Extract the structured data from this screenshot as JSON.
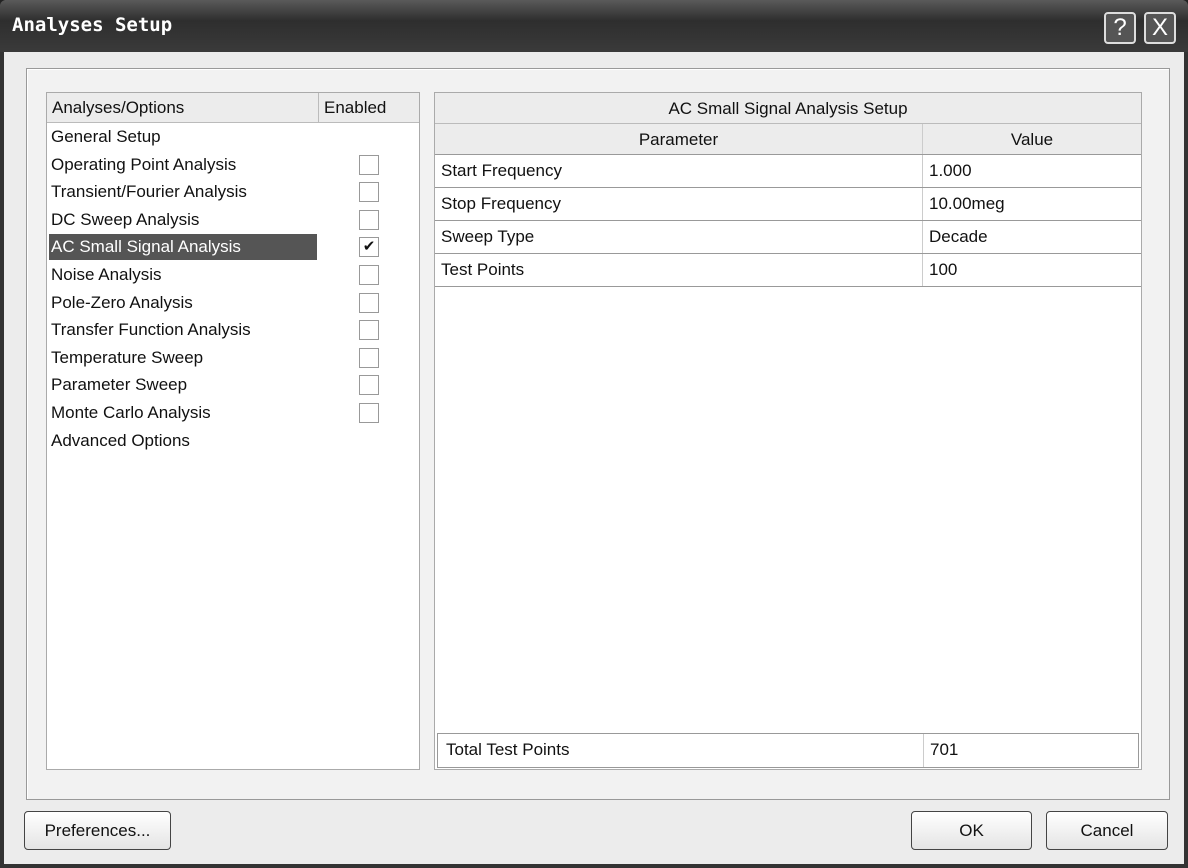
{
  "window": {
    "title": "Analyses Setup",
    "help": "?",
    "close": "X"
  },
  "left": {
    "col1": "Analyses/Options",
    "col2": "Enabled",
    "items": [
      {
        "label": "General Setup",
        "checkbox": false
      },
      {
        "label": "Operating Point Analysis",
        "checkbox": true,
        "checked": false
      },
      {
        "label": "Transient/Fourier Analysis",
        "checkbox": true,
        "checked": false
      },
      {
        "label": "DC Sweep Analysis",
        "checkbox": true,
        "checked": false
      },
      {
        "label": "AC Small Signal Analysis",
        "checkbox": true,
        "checked": true,
        "selected": true
      },
      {
        "label": "Noise Analysis",
        "checkbox": true,
        "checked": false
      },
      {
        "label": "Pole-Zero Analysis",
        "checkbox": true,
        "checked": false
      },
      {
        "label": "Transfer Function Analysis",
        "checkbox": true,
        "checked": false
      },
      {
        "label": "Temperature Sweep",
        "checkbox": true,
        "checked": false
      },
      {
        "label": "Parameter Sweep",
        "checkbox": true,
        "checked": false
      },
      {
        "label": "Monte Carlo Analysis",
        "checkbox": true,
        "checked": false
      },
      {
        "label": "Advanced Options",
        "checkbox": false
      }
    ]
  },
  "right": {
    "title": "AC Small Signal Analysis Setup",
    "col1": "Parameter",
    "col2": "Value",
    "rows": [
      [
        "Start Frequency",
        "1.000"
      ],
      [
        "Stop Frequency",
        "10.00meg"
      ],
      [
        "Sweep Type",
        "Decade"
      ],
      [
        "Test Points",
        "100"
      ]
    ],
    "total_label": "Total Test Points",
    "total_value": "701"
  },
  "buttons": {
    "preferences": "Preferences...",
    "ok": "OK",
    "cancel": "Cancel"
  }
}
